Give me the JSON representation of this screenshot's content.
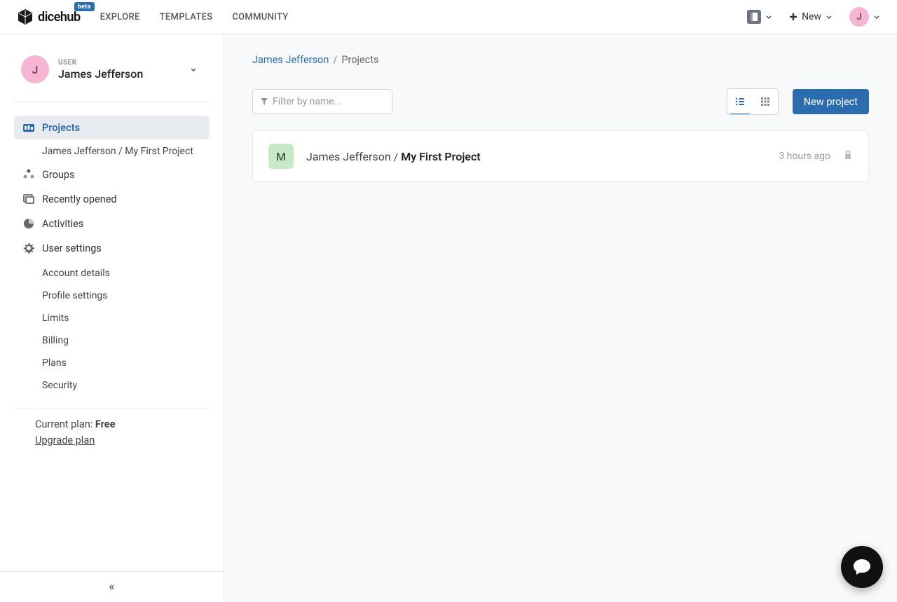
{
  "brand": {
    "name": "dicehub",
    "badge": "beta"
  },
  "topNav": {
    "items": [
      "EXPLORE",
      "TEMPLATES",
      "COMMUNITY"
    ]
  },
  "headerRight": {
    "newLabel": "New",
    "avatarInitial": "J"
  },
  "sidebar": {
    "userLabel": "USER",
    "userName": "James Jefferson",
    "userInitial": "J",
    "nav": {
      "projects": "Projects",
      "projectSub": "James Jefferson / My First Project",
      "groups": "Groups",
      "recent": "Recently opened",
      "activities": "Activities",
      "userSettings": "User settings"
    },
    "settingsSub": {
      "account": "Account details",
      "profile": "Profile settings",
      "limits": "Limits",
      "billing": "Billing",
      "plans": "Plans",
      "security": "Security"
    },
    "plan": {
      "prefix": "Current plan: ",
      "value": "Free",
      "upgrade": "Upgrade plan"
    },
    "collapse": "«"
  },
  "breadcrumb": {
    "link": "James Jefferson",
    "sep": "/",
    "current": "Projects"
  },
  "toolbar": {
    "filterPlaceholder": "Filter by name...",
    "newProject": "New project"
  },
  "project": {
    "initial": "M",
    "owner": "James Jefferson / ",
    "name": "My First Project",
    "time": "3 hours ago"
  }
}
